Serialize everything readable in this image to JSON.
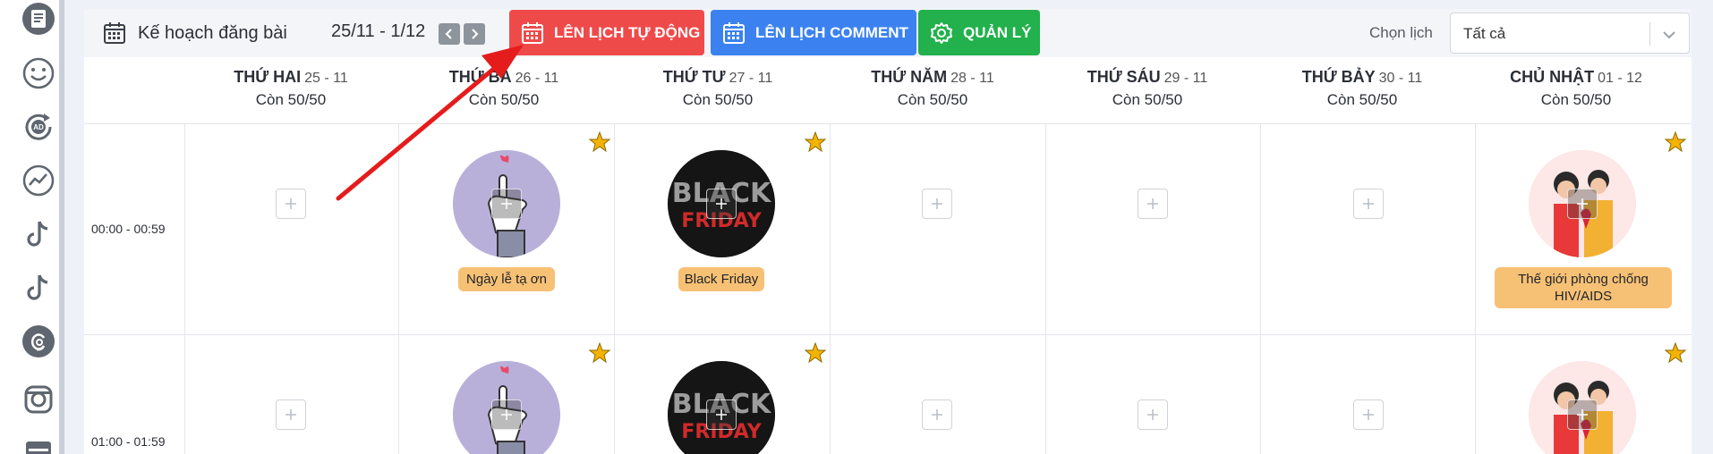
{
  "toolbar": {
    "plan_title": "Kế hoạch đăng bài",
    "date_range": "25/11 - 1/12",
    "btn_auto_schedule": "LÊN LỊCH TỰ ĐỘNG",
    "btn_comment_schedule": "LÊN LỊCH COMMENT",
    "btn_manage": "QUẢN LÝ",
    "calendar_select_label": "Chọn lịch",
    "calendar_select_value": "Tất cả"
  },
  "days": [
    {
      "name": "THỨ HAI",
      "date": "25 - 11",
      "remaining": "Còn 50/50"
    },
    {
      "name": "THỨ BA",
      "date": "26 - 11",
      "remaining": "Còn 50/50"
    },
    {
      "name": "THỨ TƯ",
      "date": "27 - 11",
      "remaining": "Còn 50/50"
    },
    {
      "name": "THỨ NĂM",
      "date": "28 - 11",
      "remaining": "Còn 50/50"
    },
    {
      "name": "THỨ SÁU",
      "date": "29 - 11",
      "remaining": "Còn 50/50"
    },
    {
      "name": "THỨ BẢY",
      "date": "30 - 11",
      "remaining": "Còn 50/50"
    },
    {
      "name": "CHỦ NHẬT",
      "date": "01 - 12",
      "remaining": "Còn 50/50"
    }
  ],
  "time_slots": [
    "00:00 - 00:59",
    "01:00 - 01:59"
  ],
  "events": {
    "tue": "Ngày lễ tạ ơn",
    "wed": "Black Friday",
    "sun_line1": "Thế giới phòng chống",
    "sun_line2": "HIV/AIDS"
  },
  "thumb_text": {
    "black": "BLACK",
    "friday": "FRIDAY"
  },
  "colors": {
    "accent_red": "#ef4a4a",
    "accent_blue": "#3b82f0",
    "accent_green": "#22b14c",
    "event_tag": "#f7c175",
    "star": "#f5b301"
  },
  "icons": {
    "rail": [
      "news-icon",
      "smiley-icon",
      "ad-refresh-icon",
      "analytics-icon",
      "tiktok-icon",
      "tiktok-icon",
      "threads-icon",
      "instagram-icon",
      "calendar-icon"
    ]
  }
}
